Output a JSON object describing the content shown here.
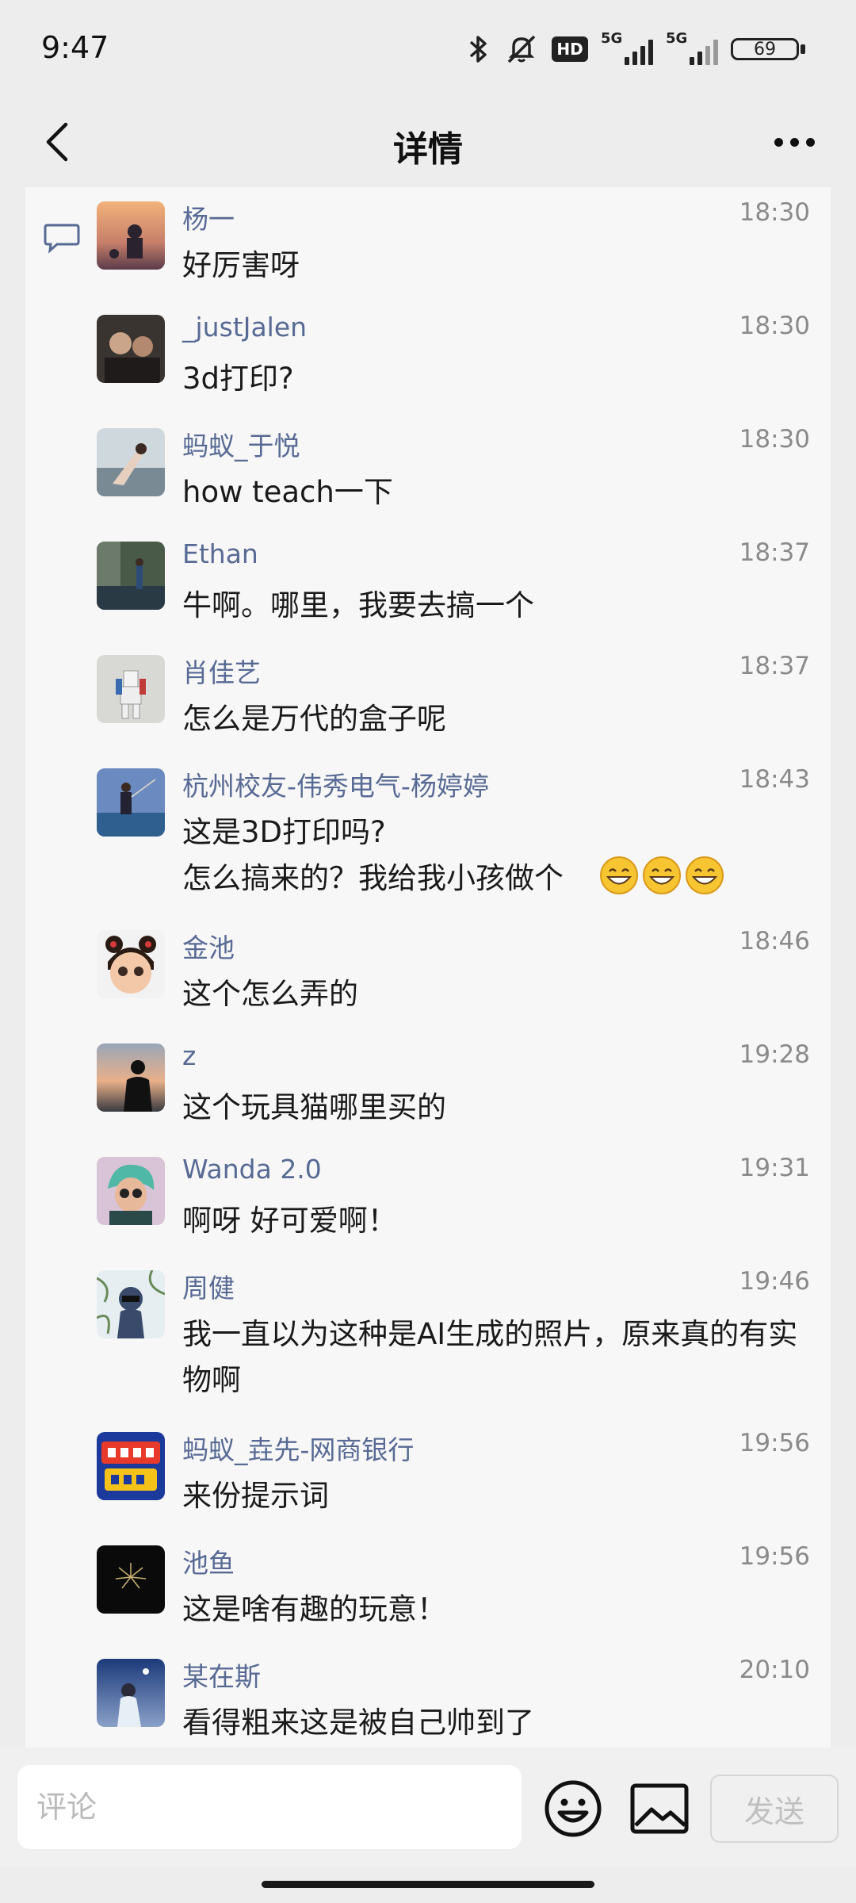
{
  "status": {
    "time": "9:47",
    "battery": "69",
    "hd_label": "HD",
    "signal_1": "5G",
    "signal_2": "5G"
  },
  "header": {
    "title": "详情"
  },
  "comments": [
    {
      "name": "杨一",
      "time": "18:30",
      "text": "好厉害呀"
    },
    {
      "name": "_justJalen",
      "time": "18:30",
      "text": "3d打印?"
    },
    {
      "name": "蚂蚁_于悦",
      "time": "18:30",
      "text": "how teach一下"
    },
    {
      "name": "Ethan",
      "time": "18:37",
      "text": "牛啊。哪里，我要去搞一个"
    },
    {
      "name": "肖佳艺",
      "time": "18:37",
      "text": "怎么是万代的盒子呢"
    },
    {
      "name": "杭州校友-伟秀电气-杨婷婷",
      "time": "18:43",
      "text": "这是3D打印吗?\n怎么搞来的？我给我小孩做个"
    },
    {
      "name": "金池",
      "time": "18:46",
      "text": "这个怎么弄的"
    },
    {
      "name": "z",
      "time": "19:28",
      "text": "这个玩具猫哪里买的"
    },
    {
      "name": "Wanda 2.0",
      "time": "19:31",
      "text": "啊呀 好可爱啊！"
    },
    {
      "name": "周健",
      "time": "19:46",
      "text": "我一直以为这种是AI生成的照片，原来真的有实物啊"
    },
    {
      "name": "蚂蚁_垚先-网商银行",
      "time": "19:56",
      "text": "来份提示词"
    },
    {
      "name": "池鱼",
      "time": "19:56",
      "text": "这是啥有趣的玩意！"
    },
    {
      "name": "某在斯",
      "time": "20:10",
      "text": "看得粗来这是被自己帅到了"
    }
  ],
  "input": {
    "placeholder": "评论",
    "send_label": "发送"
  },
  "icons": {
    "back": "chevron-left-icon",
    "more": "more-dots-icon",
    "comment": "comment-bubble-icon",
    "emoji": "emoji-icon",
    "image": "image-icon"
  }
}
